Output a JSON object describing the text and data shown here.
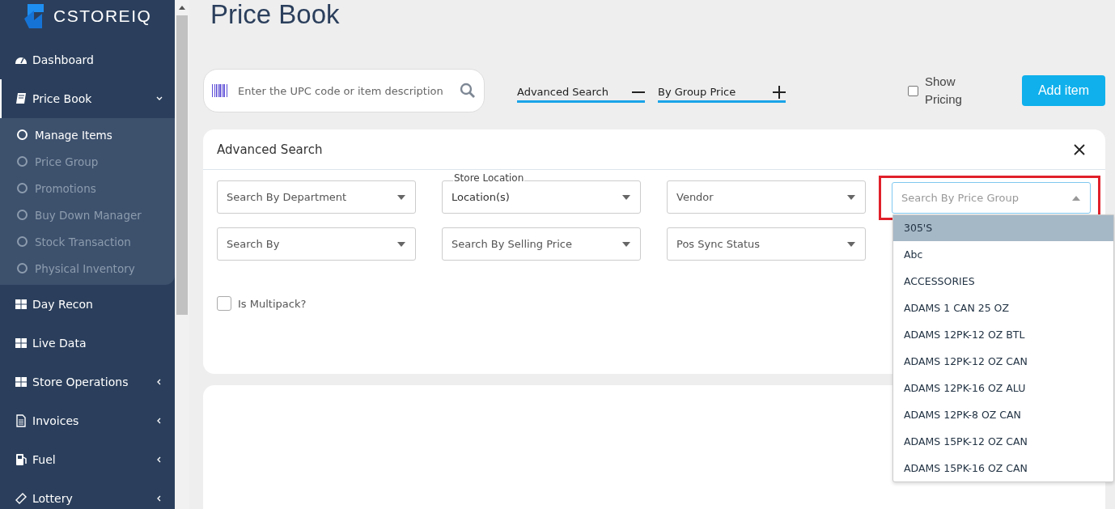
{
  "sidebar": {
    "brand": "CSTOREIQ",
    "items": [
      {
        "label": "Dashboard",
        "selected": false
      },
      {
        "label": "Price Book",
        "expanded": true,
        "selected": true,
        "children": [
          {
            "label": "Manage Items",
            "selected": true
          },
          {
            "label": "Price Group",
            "selected": false
          },
          {
            "label": "Promotions",
            "selected": false
          },
          {
            "label": "Buy Down Manager",
            "selected": false
          },
          {
            "label": "Stock Transaction",
            "selected": false
          },
          {
            "label": "Physical Inventory",
            "selected": false
          }
        ]
      },
      {
        "label": "Day Recon",
        "selected": false
      },
      {
        "label": "Live Data",
        "selected": false
      },
      {
        "label": "Store Operations",
        "expanded": false,
        "selected": false
      },
      {
        "label": "Invoices",
        "expanded": false,
        "selected": false
      },
      {
        "label": "Fuel",
        "expanded": false,
        "selected": false
      },
      {
        "label": "Lottery",
        "expanded": false,
        "selected": false
      }
    ]
  },
  "page_title": "Price Book",
  "toolbar": {
    "search": {
      "placeholder": "Enter the UPC code or item description"
    },
    "filter_tabs": [
      {
        "label": "Advanced Search",
        "expanded": true
      },
      {
        "label": "By Group Price",
        "expanded": false
      }
    ],
    "show_pricing": {
      "label": "Show Pricing",
      "checked": false
    },
    "add_button": "Add item"
  },
  "advanced_search": {
    "title": "Advanced Search",
    "fields": [
      {
        "placeholder": "Search By Department",
        "open": false
      },
      {
        "label": "Store Location",
        "placeholder": "Location(s)",
        "open": false
      },
      {
        "placeholder": "Vendor",
        "open": false
      },
      {
        "placeholder": "Search By Price Group",
        "open": true
      },
      {
        "placeholder": "Search By",
        "open": false
      },
      {
        "placeholder": "Search By Selling Price",
        "open": false
      },
      {
        "placeholder": "Pos Sync Status",
        "open": false
      }
    ],
    "multipack": {
      "label": "Is Multipack?",
      "checked": false
    },
    "dropdown_options": [
      {
        "label": "305'S",
        "selected": true
      },
      {
        "label": "Abc",
        "selected": false
      },
      {
        "label": "ACCESSORIES",
        "selected": false
      },
      {
        "label": "ADAMS 1 CAN 25 OZ",
        "selected": false
      },
      {
        "label": "ADAMS 12PK-12 OZ BTL",
        "selected": false
      },
      {
        "label": "ADAMS 12PK-12 OZ CAN",
        "selected": false
      },
      {
        "label": "ADAMS 12PK-16 OZ ALU",
        "selected": false
      },
      {
        "label": "ADAMS 12PK-8 OZ CAN",
        "selected": false
      },
      {
        "label": "ADAMS 15PK-12 OZ CAN",
        "selected": false
      },
      {
        "label": "ADAMS 15PK-16 OZ CAN",
        "selected": false
      }
    ]
  }
}
